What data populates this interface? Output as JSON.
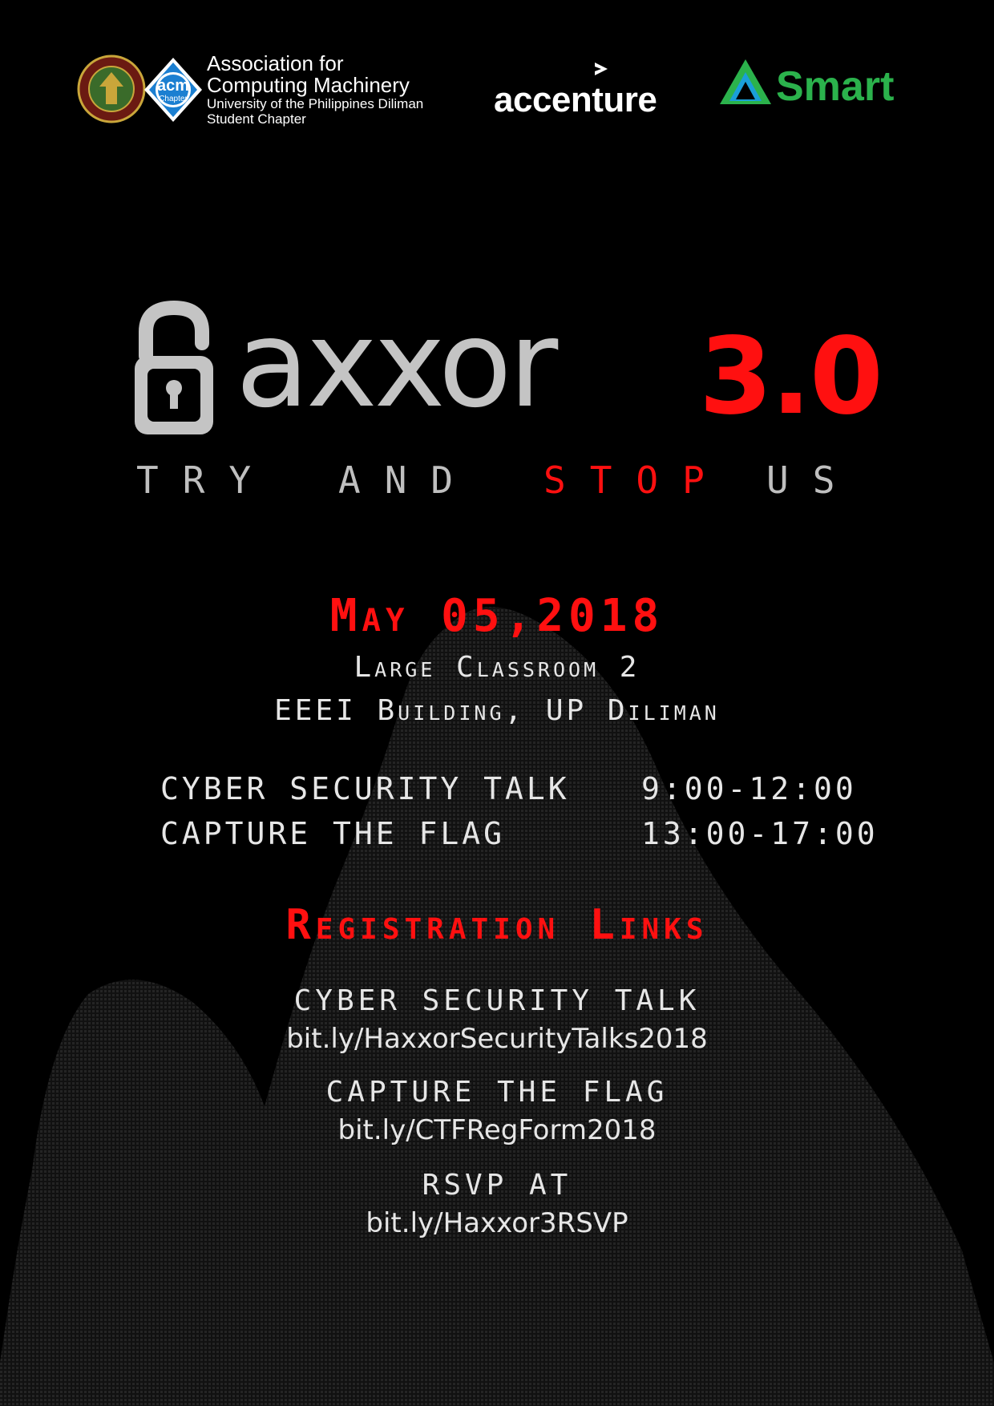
{
  "header": {
    "acm_line1": "Association for",
    "acm_line2": "Computing Machinery",
    "acm_line3": "University of the Philippines Diliman",
    "acm_line4": "Student Chapter",
    "acm_badge_text": "acm",
    "acm_badge_sub": "Chapter",
    "accenture": "accenture",
    "smart": "Smart",
    "colors": {
      "smart_green": "#2bb24c",
      "acm_blue": "#1b7fd1"
    }
  },
  "title": {
    "word": "axxor",
    "version": "3.0",
    "tagline": {
      "try": "TRY",
      "and": "AND",
      "stop": "STOP",
      "us": "US"
    },
    "accent_color": "#ff1010"
  },
  "event": {
    "date": "May 05,2018",
    "venue_line1": "Large Classroom 2",
    "venue_line2": "EEEI Building, UP Diliman"
  },
  "schedule": [
    {
      "name": "CYBER SECURITY TALK",
      "time": "9:00-12:00"
    },
    {
      "name": "CAPTURE THE FLAG",
      "time": "13:00-17:00"
    }
  ],
  "registration": {
    "heading": "Registration Links",
    "items": [
      {
        "label": "CYBER SECURITY TALK",
        "link": "bit.ly/HaxxorSecurityTalks2018"
      },
      {
        "label": "CAPTURE THE FLAG",
        "link": "bit.ly/CTFRegForm2018"
      },
      {
        "label": "RSVP AT",
        "link": "bit.ly/Haxxor3RSVP"
      }
    ]
  }
}
